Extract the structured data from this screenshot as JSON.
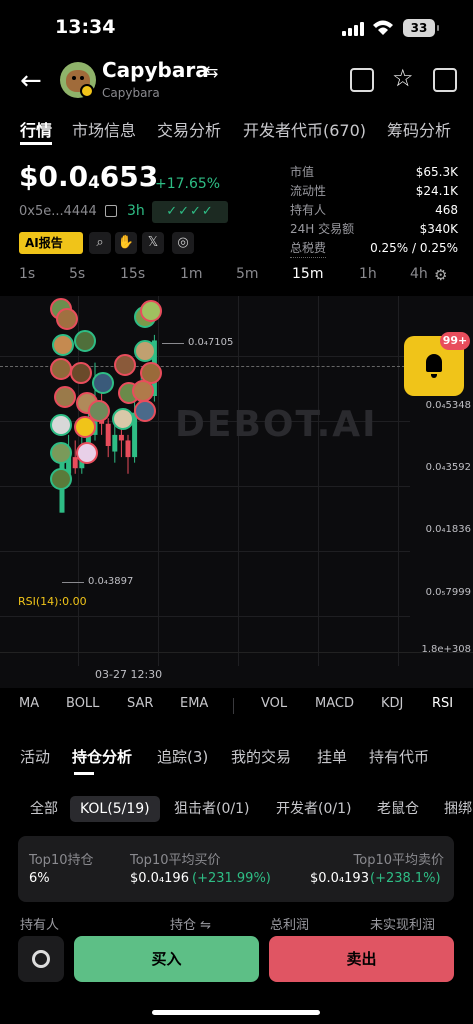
{
  "status": {
    "time": "13:34",
    "battery": "33"
  },
  "header": {
    "name": "Capybara",
    "subname": "Capybara"
  },
  "main_tabs": [
    "行情",
    "市场信息",
    "交易分析",
    "开发者代币(670)",
    "筹码分析"
  ],
  "price": {
    "prefix": "$0.0",
    "zeros": "4",
    "digits": "653",
    "change": "+17.65%",
    "address": "0x5e...4444",
    "age": "3h",
    "checks": "✓✓✓✓",
    "ai_label": "AI报告"
  },
  "stats": [
    {
      "label": "市值",
      "value": "$65.3K"
    },
    {
      "label": "流动性",
      "value": "$24.1K"
    },
    {
      "label": "持有人",
      "value": "468"
    },
    {
      "label": "24H 交易额",
      "value": "$340K"
    },
    {
      "label": "总税费",
      "value": "0.25% / 0.25%"
    }
  ],
  "timeframes": [
    "1s",
    "5s",
    "15s",
    "1m",
    "5m",
    "15m",
    "1h",
    "4h"
  ],
  "active_timeframe": "15m",
  "chart": {
    "watermark": "DEBOT.AI",
    "high_label": "0.0₄7105",
    "low_label": "0.0₄3897",
    "y_labels": [
      "0.0₄5348",
      "0.0₄3592",
      "0.0₄1836",
      "0.0₅7999",
      "1.8e+308"
    ],
    "rsi": "RSI(14):0.00",
    "date": "03-27 12:30",
    "bell_badge": "99+"
  },
  "chart_data": {
    "type": "candlestick",
    "x": [
      "c1",
      "c2",
      "c3",
      "c4",
      "c5",
      "c6",
      "c7",
      "c8",
      "c9",
      "c10",
      "c11",
      "c12",
      "c13",
      "c14",
      "c15"
    ],
    "series": [
      {
        "values": [
          {
            "o": 3.9,
            "c": 4.8,
            "h": 5.0,
            "l": 3.9
          },
          {
            "o": 4.6,
            "c": 4.9,
            "h": 5.3,
            "l": 4.5
          },
          {
            "o": 4.9,
            "c": 4.7,
            "h": 5.2,
            "l": 4.6
          },
          {
            "o": 4.7,
            "c": 5.1,
            "h": 5.5,
            "l": 4.6
          },
          {
            "o": 5.1,
            "c": 5.3,
            "h": 6.0,
            "l": 5.0
          },
          {
            "o": 5.3,
            "c": 5.9,
            "h": 6.6,
            "l": 5.2
          },
          {
            "o": 5.9,
            "c": 5.5,
            "h": 6.2,
            "l": 5.3
          },
          {
            "o": 5.5,
            "c": 5.1,
            "h": 5.6,
            "l": 4.9
          },
          {
            "o": 5.0,
            "c": 5.3,
            "h": 5.5,
            "l": 4.8
          },
          {
            "o": 5.3,
            "c": 5.2,
            "h": 5.5,
            "l": 4.9
          },
          {
            "o": 5.2,
            "c": 4.9,
            "h": 5.3,
            "l": 4.6
          },
          {
            "o": 4.9,
            "c": 5.7,
            "h": 6.0,
            "l": 4.8
          },
          {
            "o": 5.7,
            "c": 6.2,
            "h": 6.4,
            "l": 5.6
          },
          {
            "o": 6.2,
            "c": 6.0,
            "h": 6.6,
            "l": 5.9
          },
          {
            "o": 6.0,
            "c": 7.0,
            "h": 7.1,
            "l": 5.9
          }
        ]
      }
    ],
    "ylim": [
      1.5,
      7.8
    ]
  },
  "indicators": [
    "MA",
    "BOLL",
    "SAR",
    "EMA",
    "VOL",
    "MACD",
    "KDJ",
    "RSI"
  ],
  "active_indicator": "RSI",
  "section_tabs": [
    "活动",
    "持仓分析",
    "追踪(3)",
    "我的交易",
    "挂单",
    "持有代币"
  ],
  "filters": [
    "全部",
    "KOL(5/19)",
    "狙击者(0/1)",
    "开发者(0/1)",
    "老鼠仓",
    "捆绑"
  ],
  "top10": {
    "hold_label": "Top10持仓",
    "hold_value": "6%",
    "buy_label": "Top10平均买价",
    "buy_value": "$0.0₄196",
    "buy_pct": "(+231.99%)",
    "sell_label": "Top10平均卖价",
    "sell_value": "$0.0₄193",
    "sell_pct": "(+238.1%)"
  },
  "holder_headers": [
    "持有人",
    "持仓 ⇋",
    "总利润",
    "未实现利润"
  ],
  "actions": {
    "buy": "买入",
    "sell": "卖出"
  },
  "colors": {
    "up": "#2ebd85",
    "down": "#e84d5c",
    "accent": "#f0c419"
  }
}
